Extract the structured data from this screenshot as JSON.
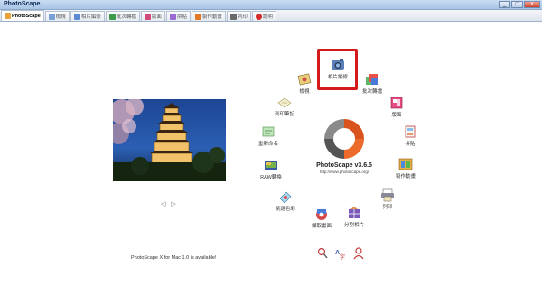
{
  "window": {
    "title": "PhotoScape",
    "minimize": "_",
    "maximize": "□",
    "close": "X"
  },
  "tabs": [
    {
      "label": "PhotoScape",
      "active": true,
      "icon": "home-icon",
      "color": "#e8a23a"
    },
    {
      "label": "檢視",
      "active": false,
      "icon": "viewer-icon",
      "color": "#7aa0d8"
    },
    {
      "label": "相片編修",
      "active": false,
      "icon": "editor-icon",
      "color": "#5a8ad0"
    },
    {
      "label": "批次轉檔",
      "active": false,
      "icon": "batch-icon",
      "color": "#3d9a4b"
    },
    {
      "label": "版面",
      "active": false,
      "icon": "page-icon",
      "color": "#d04a7a"
    },
    {
      "label": "拼貼",
      "active": false,
      "icon": "combine-icon",
      "color": "#9a6ad0"
    },
    {
      "label": "製作動畫",
      "active": false,
      "icon": "gif-icon",
      "color": "#e07a2a"
    },
    {
      "label": "列印",
      "active": false,
      "icon": "print-icon",
      "color": "#6a6a6a"
    },
    {
      "label": "說明",
      "active": false,
      "icon": "help-icon",
      "color": "#d42a2a"
    }
  ],
  "menu": [
    {
      "id": "editor",
      "label": "相片編修",
      "icon": "editor-icon"
    },
    {
      "id": "viewer",
      "label": "檢視",
      "icon": "viewer-icon"
    },
    {
      "id": "batch",
      "label": "批次轉檔",
      "icon": "batch-editor-icon"
    },
    {
      "id": "print-note",
      "label": "列印筆記",
      "icon": "notepad-icon"
    },
    {
      "id": "page",
      "label": "版面",
      "icon": "page-layout-icon"
    },
    {
      "id": "rename",
      "label": "重新命名",
      "icon": "rename-icon"
    },
    {
      "id": "combine",
      "label": "拼貼",
      "icon": "combine-icon"
    },
    {
      "id": "raw",
      "label": "RAW轉換",
      "icon": "raw-converter-icon"
    },
    {
      "id": "gif",
      "label": "製作動畫",
      "icon": "animated-gif-icon"
    },
    {
      "id": "color",
      "label": "挑選色彩",
      "icon": "color-picker-icon"
    },
    {
      "id": "print",
      "label": "列印",
      "icon": "print-icon"
    },
    {
      "id": "capture",
      "label": "擷取畫面",
      "icon": "screen-capture-icon"
    },
    {
      "id": "split",
      "label": "分割相片",
      "icon": "splitter-icon"
    }
  ],
  "logo": {
    "name": "PhotoScape v3.6.5",
    "url": "http://www.photoscape.org/"
  },
  "notice": "PhotoScape X for Mac 1.0 is available!",
  "controls": {
    "prev": "◁",
    "next": "▷"
  },
  "bottom_icons": [
    "search-tool-icon",
    "language-icon",
    "users-icon"
  ],
  "colors": {
    "highlight": "#d41b1b",
    "titlebar": "#a9c4e6"
  }
}
